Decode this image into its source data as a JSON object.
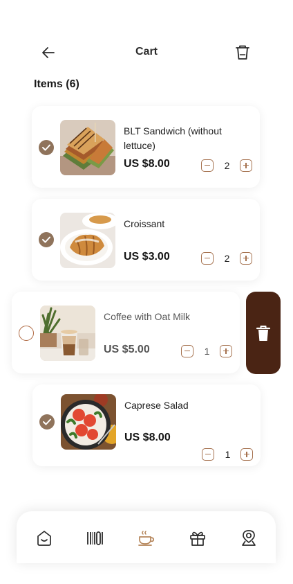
{
  "header": {
    "title": "Cart"
  },
  "items_heading": "Items (6)",
  "cart_items": [
    {
      "name": "BLT Sandwich (without lettuce)",
      "price": "US $8.00",
      "qty": "2",
      "selected": true
    },
    {
      "name": "Croissant",
      "price": "US $3.00",
      "qty": "2",
      "selected": true
    },
    {
      "name": "Coffee with Oat Milk",
      "price": "US $5.00",
      "qty": "1",
      "selected": false
    },
    {
      "name": "Caprese Salad",
      "price": "US $8.00",
      "qty": "1",
      "selected": true
    }
  ],
  "icons": {
    "back": "arrow-left-icon",
    "header_delete": "trash-icon",
    "swipe_delete": "trash-icon",
    "nav": [
      "home-icon",
      "barcode-icon",
      "coffee-cup-icon",
      "gift-icon",
      "location-icon"
    ]
  },
  "nav_active": "coffee-cup-icon",
  "colors": {
    "accent": "#8f735b",
    "stepper_border": "#a5714e",
    "delete_bg": "#4a2414",
    "active_nav": "#b5855a"
  }
}
